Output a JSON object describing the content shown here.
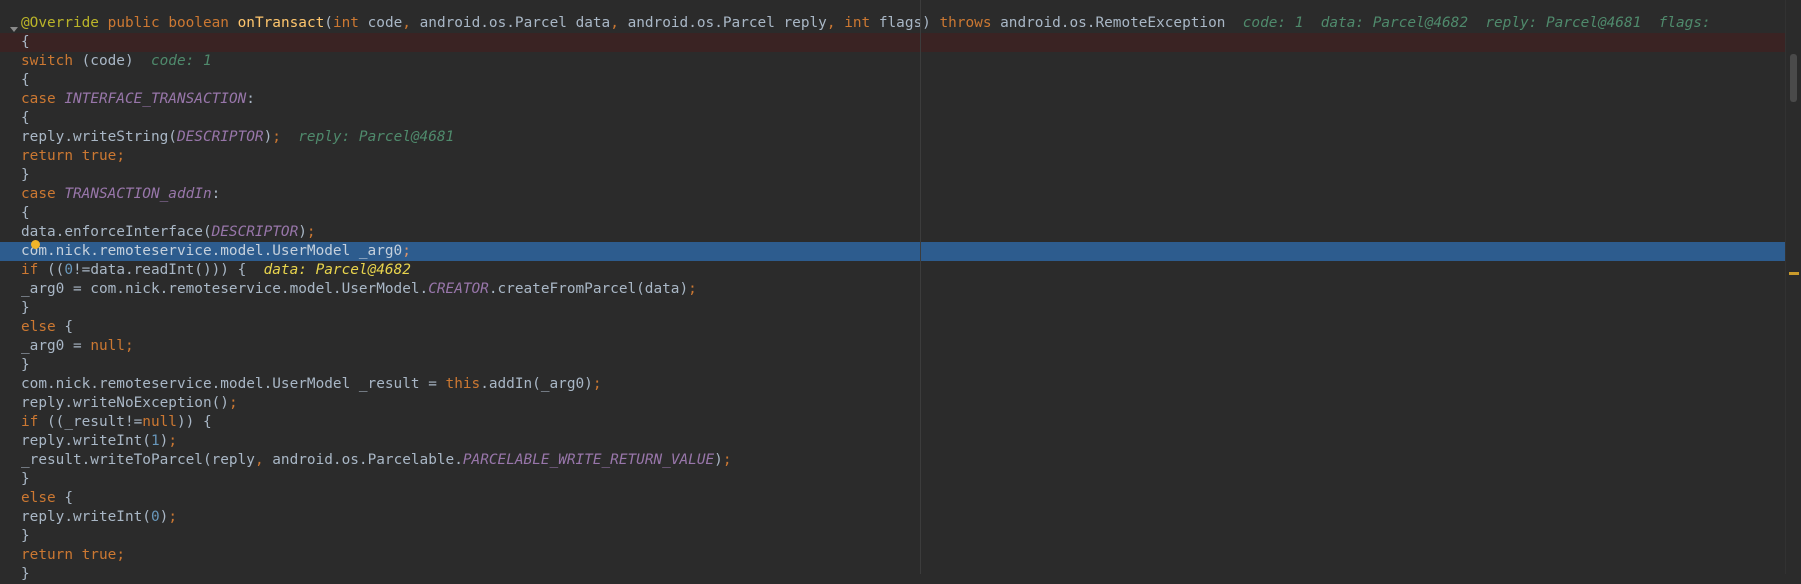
{
  "editor": {
    "language": "java",
    "current_line_index": 13,
    "exec_line_index": 2,
    "lines": [
      {
        "tokens": [
          {
            "t": "   ",
            "c": "plain"
          }
        ]
      },
      {
        "tokens": [
          {
            "t": "@Override",
            "c": "ann"
          },
          {
            "t": " ",
            "c": "plain"
          },
          {
            "t": "public",
            "c": "kw"
          },
          {
            "t": " ",
            "c": "plain"
          },
          {
            "t": "boolean",
            "c": "kw"
          },
          {
            "t": " ",
            "c": "plain"
          },
          {
            "t": "onTransact",
            "c": "method"
          },
          {
            "t": "(",
            "c": "plain"
          },
          {
            "t": "int",
            "c": "kw"
          },
          {
            "t": " code",
            "c": "plain"
          },
          {
            "t": ",",
            "c": "kw"
          },
          {
            "t": " android.os.Parcel data",
            "c": "plain"
          },
          {
            "t": ",",
            "c": "kw"
          },
          {
            "t": " android.os.Parcel reply",
            "c": "plain"
          },
          {
            "t": ",",
            "c": "kw"
          },
          {
            "t": " ",
            "c": "plain"
          },
          {
            "t": "int",
            "c": "kw"
          },
          {
            "t": " flags) ",
            "c": "plain"
          },
          {
            "t": "throws",
            "c": "kw"
          },
          {
            "t": " android.os.RemoteException  ",
            "c": "plain"
          },
          {
            "t": "code: 1  data: Parcel@4682  reply: Parcel@4681  flags: ",
            "c": "hint"
          }
        ]
      },
      {
        "tokens": [
          {
            "t": "{",
            "c": "plain"
          }
        ]
      },
      {
        "tokens": [
          {
            "t": "switch",
            "c": "kw"
          },
          {
            "t": " (code)  ",
            "c": "plain"
          },
          {
            "t": "code: 1",
            "c": "hint"
          }
        ]
      },
      {
        "tokens": [
          {
            "t": "{",
            "c": "plain"
          }
        ]
      },
      {
        "tokens": [
          {
            "t": "case",
            "c": "kw"
          },
          {
            "t": " ",
            "c": "plain"
          },
          {
            "t": "INTERFACE_TRANSACTION",
            "c": "const"
          },
          {
            "t": ":",
            "c": "plain"
          }
        ]
      },
      {
        "tokens": [
          {
            "t": "{",
            "c": "plain"
          }
        ]
      },
      {
        "tokens": [
          {
            "t": "reply.writeString(",
            "c": "plain"
          },
          {
            "t": "DESCRIPTOR",
            "c": "const"
          },
          {
            "t": ")",
            "c": "plain"
          },
          {
            "t": ";",
            "c": "kw"
          },
          {
            "t": "  ",
            "c": "plain"
          },
          {
            "t": "reply: Parcel@4681",
            "c": "hint"
          }
        ]
      },
      {
        "tokens": [
          {
            "t": "return true",
            "c": "kw"
          },
          {
            "t": ";",
            "c": "kw"
          }
        ]
      },
      {
        "tokens": [
          {
            "t": "}",
            "c": "plain"
          }
        ]
      },
      {
        "tokens": [
          {
            "t": "case",
            "c": "kw"
          },
          {
            "t": " ",
            "c": "plain"
          },
          {
            "t": "TRANSACTION_addIn",
            "c": "const"
          },
          {
            "t": ":",
            "c": "plain"
          }
        ]
      },
      {
        "tokens": [
          {
            "t": "{",
            "c": "plain"
          }
        ]
      },
      {
        "tokens": [
          {
            "t": "data.enforceInterface(",
            "c": "plain"
          },
          {
            "t": "DESCRIPTOR",
            "c": "const"
          },
          {
            "t": ")",
            "c": "plain"
          },
          {
            "t": ";",
            "c": "kw"
          }
        ]
      },
      {
        "tokens": [
          {
            "t": "com.nick.remoteservice.model.UserModel _arg0",
            "c": "plain"
          },
          {
            "t": ";",
            "c": "kw"
          }
        ]
      },
      {
        "tokens": [
          {
            "t": "if",
            "c": "kw"
          },
          {
            "t": " ((",
            "c": "plain"
          },
          {
            "t": "0",
            "c": "num"
          },
          {
            "t": "!=data.readInt())) {  ",
            "c": "plain"
          },
          {
            "t": "data: Parcel@4682",
            "c": "hintcur"
          }
        ]
      },
      {
        "tokens": [
          {
            "t": "_arg0 = com.nick.remoteservice.model.UserModel.",
            "c": "plain"
          },
          {
            "t": "CREATOR",
            "c": "const"
          },
          {
            "t": ".createFromParcel(data)",
            "c": "plain"
          },
          {
            "t": ";",
            "c": "kw"
          }
        ]
      },
      {
        "tokens": [
          {
            "t": "}",
            "c": "plain"
          }
        ]
      },
      {
        "tokens": [
          {
            "t": "else",
            "c": "kw"
          },
          {
            "t": " {",
            "c": "plain"
          }
        ]
      },
      {
        "tokens": [
          {
            "t": "_arg0 = ",
            "c": "plain"
          },
          {
            "t": "null",
            "c": "kw"
          },
          {
            "t": ";",
            "c": "kw"
          }
        ]
      },
      {
        "tokens": [
          {
            "t": "}",
            "c": "plain"
          }
        ]
      },
      {
        "tokens": [
          {
            "t": "com.nick.remoteservice.model.UserModel _result = ",
            "c": "plain"
          },
          {
            "t": "this",
            "c": "kw"
          },
          {
            "t": ".addIn(_arg0)",
            "c": "plain"
          },
          {
            "t": ";",
            "c": "kw"
          }
        ]
      },
      {
        "tokens": [
          {
            "t": "reply.writeNoException()",
            "c": "plain"
          },
          {
            "t": ";",
            "c": "kw"
          }
        ]
      },
      {
        "tokens": [
          {
            "t": "if",
            "c": "kw"
          },
          {
            "t": " ((_result!=",
            "c": "plain"
          },
          {
            "t": "null",
            "c": "kw"
          },
          {
            "t": ")) {",
            "c": "plain"
          }
        ]
      },
      {
        "tokens": [
          {
            "t": "reply.writeInt(",
            "c": "plain"
          },
          {
            "t": "1",
            "c": "num"
          },
          {
            "t": ")",
            "c": "plain"
          },
          {
            "t": ";",
            "c": "kw"
          }
        ]
      },
      {
        "tokens": [
          {
            "t": "_result.writeToParcel(reply",
            "c": "plain"
          },
          {
            "t": ",",
            "c": "kw"
          },
          {
            "t": " android.os.Parcelable.",
            "c": "plain"
          },
          {
            "t": "PARCELABLE_WRITE_RETURN_VALUE",
            "c": "const"
          },
          {
            "t": ")",
            "c": "plain"
          },
          {
            "t": ";",
            "c": "kw"
          }
        ]
      },
      {
        "tokens": [
          {
            "t": "}",
            "c": "plain"
          }
        ]
      },
      {
        "tokens": [
          {
            "t": "else",
            "c": "kw"
          },
          {
            "t": " {",
            "c": "plain"
          }
        ]
      },
      {
        "tokens": [
          {
            "t": "reply.writeInt(",
            "c": "plain"
          },
          {
            "t": "0",
            "c": "num"
          },
          {
            "t": ")",
            "c": "plain"
          },
          {
            "t": ";",
            "c": "kw"
          }
        ]
      },
      {
        "tokens": [
          {
            "t": "}",
            "c": "plain"
          }
        ]
      },
      {
        "tokens": [
          {
            "t": "return true",
            "c": "kw"
          },
          {
            "t": ";",
            "c": "kw"
          }
        ]
      },
      {
        "tokens": [
          {
            "t": "}",
            "c": "plain"
          }
        ]
      }
    ]
  },
  "icons": {
    "fold": "fold-arrow-icon",
    "pointer": "mouse-cursor-icon",
    "stripe_mark": "warning-stripe-mark"
  },
  "colors": {
    "background": "#2b2b2b",
    "current_line": "#2d5c8e",
    "exec_line": "#3a2323",
    "keyword": "#cc7832",
    "annotation": "#bbb529",
    "constant": "#9876aa",
    "number": "#6897bb",
    "hint": "#4f8a6c"
  }
}
